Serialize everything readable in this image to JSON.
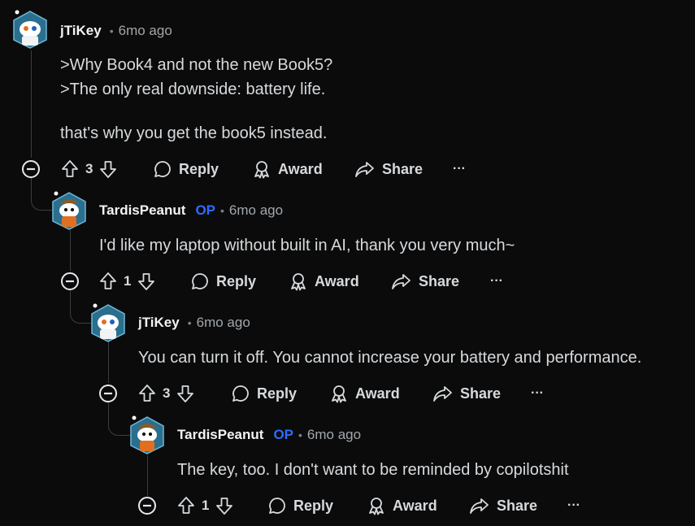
{
  "comments": [
    {
      "author": "jTiKey",
      "op_badge": "",
      "time": "6mo ago",
      "body": [
        ">Why Book4 and not the new Book5?",
        ">The only real downside: battery life.",
        "that's why you get the book5 instead."
      ],
      "votes": "3",
      "reply": "Reply",
      "award": "Award",
      "share": "Share",
      "more": "···"
    },
    {
      "author": "TardisPeanut",
      "op_badge": "OP",
      "time": "6mo ago",
      "body": [
        "I'd like my laptop without built in AI, thank you very much~"
      ],
      "votes": "1",
      "reply": "Reply",
      "award": "Award",
      "share": "Share",
      "more": "···"
    },
    {
      "author": "jTiKey",
      "op_badge": "",
      "time": "6mo ago",
      "body": [
        "You can turn it off. You cannot increase your battery and performance."
      ],
      "votes": "3",
      "reply": "Reply",
      "award": "Award",
      "share": "Share",
      "more": "···"
    },
    {
      "author": "TardisPeanut",
      "op_badge": "OP",
      "time": "6mo ago",
      "body": [
        "The key, too. I don't want to be reminded by copilotshit"
      ],
      "votes": "1",
      "reply": "Reply",
      "award": "Award",
      "share": "Share",
      "more": "···"
    }
  ],
  "separator": "•"
}
